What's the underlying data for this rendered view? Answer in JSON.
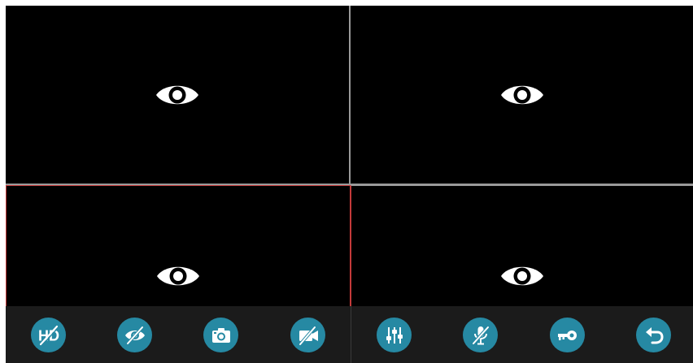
{
  "app": {
    "title": ""
  },
  "views": [
    {
      "id": "view-1",
      "icon": "eye-icon",
      "state": "inactive"
    },
    {
      "id": "view-2",
      "icon": "eye-icon",
      "state": "inactive"
    },
    {
      "id": "view-3",
      "icon": "eye-icon",
      "state": "selected"
    },
    {
      "id": "view-4",
      "icon": "eye-icon",
      "state": "inactive"
    }
  ],
  "toolbar": {
    "hd_label": "HD",
    "buttons": [
      {
        "name": "hd-off-button",
        "icon": "hd-off-icon"
      },
      {
        "name": "view-off-button",
        "icon": "eye-slash-icon"
      },
      {
        "name": "snapshot-button",
        "icon": "camera-icon"
      },
      {
        "name": "record-off-button",
        "icon": "video-off-icon"
      },
      {
        "name": "settings-button",
        "icon": "sliders-icon"
      },
      {
        "name": "mic-off-button",
        "icon": "mic-off-icon"
      },
      {
        "name": "unlock-button",
        "icon": "key-icon"
      },
      {
        "name": "back-button",
        "icon": "undo-arrow-icon"
      }
    ]
  },
  "colors": {
    "accent": "#2689a3",
    "selected_border": "#c43a3a",
    "grid_border": "#9a9a9a",
    "toolbar_bg": "#1b1b1b"
  }
}
